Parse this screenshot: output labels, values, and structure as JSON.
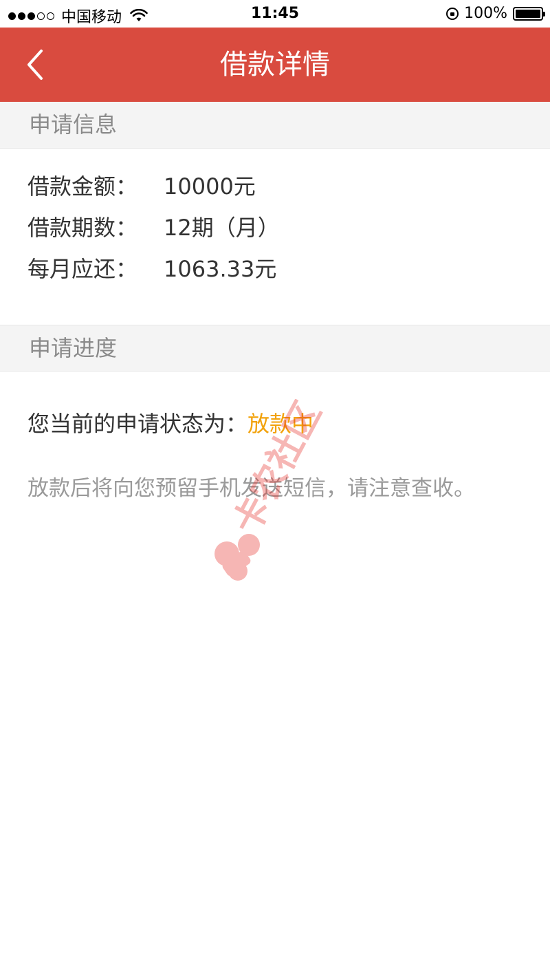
{
  "status_bar": {
    "carrier": "中国移动",
    "time": "11:45",
    "battery": "100%"
  },
  "nav": {
    "title": "借款详情",
    "back_icon": "chevron-left-icon"
  },
  "application_info": {
    "header": "申请信息",
    "rows": [
      {
        "label": "借款金额：",
        "value": "10000元"
      },
      {
        "label": "借款期数：",
        "value": "12期（月）"
      },
      {
        "label": "每月应还：",
        "value": "1063.33元"
      }
    ]
  },
  "application_progress": {
    "header": "申请进度",
    "status_label": "您当前的申请状态为：",
    "status_value": "放款中",
    "note": "放款后将向您预留手机发送短信，请注意查收。"
  },
  "colors": {
    "nav_bar": "#d94b3f",
    "status_value": "#f2a20c",
    "section_header_bg": "#f4f4f4"
  },
  "watermark_text": "卡农社区"
}
